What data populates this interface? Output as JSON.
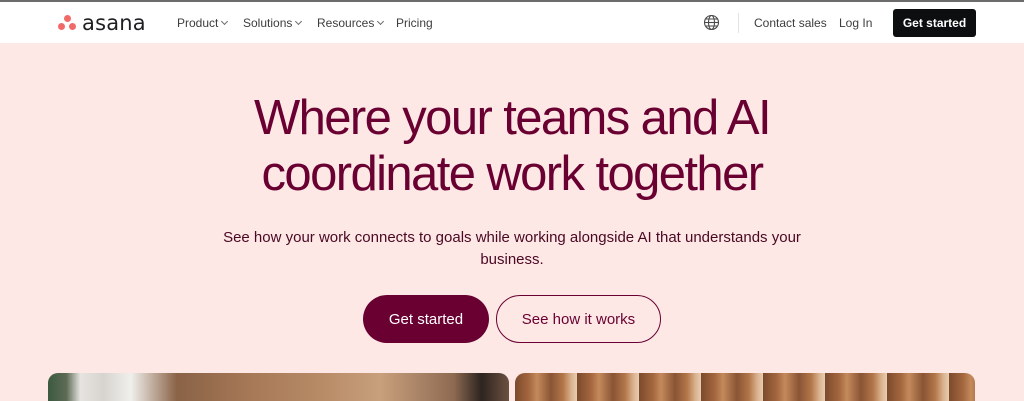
{
  "brand": {
    "name": "asana",
    "color": "#f06a6a"
  },
  "nav": {
    "items": [
      {
        "label": "Product",
        "has_dropdown": true
      },
      {
        "label": "Solutions",
        "has_dropdown": true
      },
      {
        "label": "Resources",
        "has_dropdown": true
      },
      {
        "label": "Pricing",
        "has_dropdown": false
      }
    ],
    "globe_icon": "globe-icon",
    "contact_sales": "Contact sales",
    "log_in": "Log In",
    "cta": "Get started"
  },
  "hero": {
    "headline_line1": "Where your teams and AI",
    "headline_line2": "coordinate work together",
    "subtext": "See how your work connects to goals while working alongside AI that understands your business.",
    "primary_button": "Get started",
    "secondary_button": "See how it works",
    "colors": {
      "background": "#fde8e6",
      "accent": "#690031"
    }
  }
}
